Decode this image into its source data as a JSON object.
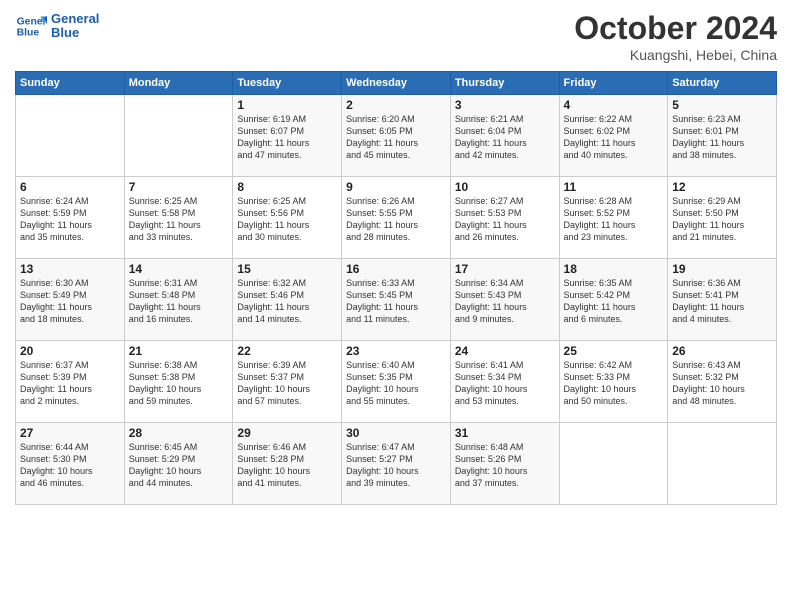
{
  "header": {
    "logo_line1": "General",
    "logo_line2": "Blue",
    "title": "October 2024",
    "subtitle": "Kuangshi, Hebei, China"
  },
  "days_of_week": [
    "Sunday",
    "Monday",
    "Tuesday",
    "Wednesday",
    "Thursday",
    "Friday",
    "Saturday"
  ],
  "weeks": [
    [
      {
        "day": "",
        "lines": []
      },
      {
        "day": "",
        "lines": []
      },
      {
        "day": "1",
        "lines": [
          "Sunrise: 6:19 AM",
          "Sunset: 6:07 PM",
          "Daylight: 11 hours",
          "and 47 minutes."
        ]
      },
      {
        "day": "2",
        "lines": [
          "Sunrise: 6:20 AM",
          "Sunset: 6:05 PM",
          "Daylight: 11 hours",
          "and 45 minutes."
        ]
      },
      {
        "day": "3",
        "lines": [
          "Sunrise: 6:21 AM",
          "Sunset: 6:04 PM",
          "Daylight: 11 hours",
          "and 42 minutes."
        ]
      },
      {
        "day": "4",
        "lines": [
          "Sunrise: 6:22 AM",
          "Sunset: 6:02 PM",
          "Daylight: 11 hours",
          "and 40 minutes."
        ]
      },
      {
        "day": "5",
        "lines": [
          "Sunrise: 6:23 AM",
          "Sunset: 6:01 PM",
          "Daylight: 11 hours",
          "and 38 minutes."
        ]
      }
    ],
    [
      {
        "day": "6",
        "lines": [
          "Sunrise: 6:24 AM",
          "Sunset: 5:59 PM",
          "Daylight: 11 hours",
          "and 35 minutes."
        ]
      },
      {
        "day": "7",
        "lines": [
          "Sunrise: 6:25 AM",
          "Sunset: 5:58 PM",
          "Daylight: 11 hours",
          "and 33 minutes."
        ]
      },
      {
        "day": "8",
        "lines": [
          "Sunrise: 6:25 AM",
          "Sunset: 5:56 PM",
          "Daylight: 11 hours",
          "and 30 minutes."
        ]
      },
      {
        "day": "9",
        "lines": [
          "Sunrise: 6:26 AM",
          "Sunset: 5:55 PM",
          "Daylight: 11 hours",
          "and 28 minutes."
        ]
      },
      {
        "day": "10",
        "lines": [
          "Sunrise: 6:27 AM",
          "Sunset: 5:53 PM",
          "Daylight: 11 hours",
          "and 26 minutes."
        ]
      },
      {
        "day": "11",
        "lines": [
          "Sunrise: 6:28 AM",
          "Sunset: 5:52 PM",
          "Daylight: 11 hours",
          "and 23 minutes."
        ]
      },
      {
        "day": "12",
        "lines": [
          "Sunrise: 6:29 AM",
          "Sunset: 5:50 PM",
          "Daylight: 11 hours",
          "and 21 minutes."
        ]
      }
    ],
    [
      {
        "day": "13",
        "lines": [
          "Sunrise: 6:30 AM",
          "Sunset: 5:49 PM",
          "Daylight: 11 hours",
          "and 18 minutes."
        ]
      },
      {
        "day": "14",
        "lines": [
          "Sunrise: 6:31 AM",
          "Sunset: 5:48 PM",
          "Daylight: 11 hours",
          "and 16 minutes."
        ]
      },
      {
        "day": "15",
        "lines": [
          "Sunrise: 6:32 AM",
          "Sunset: 5:46 PM",
          "Daylight: 11 hours",
          "and 14 minutes."
        ]
      },
      {
        "day": "16",
        "lines": [
          "Sunrise: 6:33 AM",
          "Sunset: 5:45 PM",
          "Daylight: 11 hours",
          "and 11 minutes."
        ]
      },
      {
        "day": "17",
        "lines": [
          "Sunrise: 6:34 AM",
          "Sunset: 5:43 PM",
          "Daylight: 11 hours",
          "and 9 minutes."
        ]
      },
      {
        "day": "18",
        "lines": [
          "Sunrise: 6:35 AM",
          "Sunset: 5:42 PM",
          "Daylight: 11 hours",
          "and 6 minutes."
        ]
      },
      {
        "day": "19",
        "lines": [
          "Sunrise: 6:36 AM",
          "Sunset: 5:41 PM",
          "Daylight: 11 hours",
          "and 4 minutes."
        ]
      }
    ],
    [
      {
        "day": "20",
        "lines": [
          "Sunrise: 6:37 AM",
          "Sunset: 5:39 PM",
          "Daylight: 11 hours",
          "and 2 minutes."
        ]
      },
      {
        "day": "21",
        "lines": [
          "Sunrise: 6:38 AM",
          "Sunset: 5:38 PM",
          "Daylight: 10 hours",
          "and 59 minutes."
        ]
      },
      {
        "day": "22",
        "lines": [
          "Sunrise: 6:39 AM",
          "Sunset: 5:37 PM",
          "Daylight: 10 hours",
          "and 57 minutes."
        ]
      },
      {
        "day": "23",
        "lines": [
          "Sunrise: 6:40 AM",
          "Sunset: 5:35 PM",
          "Daylight: 10 hours",
          "and 55 minutes."
        ]
      },
      {
        "day": "24",
        "lines": [
          "Sunrise: 6:41 AM",
          "Sunset: 5:34 PM",
          "Daylight: 10 hours",
          "and 53 minutes."
        ]
      },
      {
        "day": "25",
        "lines": [
          "Sunrise: 6:42 AM",
          "Sunset: 5:33 PM",
          "Daylight: 10 hours",
          "and 50 minutes."
        ]
      },
      {
        "day": "26",
        "lines": [
          "Sunrise: 6:43 AM",
          "Sunset: 5:32 PM",
          "Daylight: 10 hours",
          "and 48 minutes."
        ]
      }
    ],
    [
      {
        "day": "27",
        "lines": [
          "Sunrise: 6:44 AM",
          "Sunset: 5:30 PM",
          "Daylight: 10 hours",
          "and 46 minutes."
        ]
      },
      {
        "day": "28",
        "lines": [
          "Sunrise: 6:45 AM",
          "Sunset: 5:29 PM",
          "Daylight: 10 hours",
          "and 44 minutes."
        ]
      },
      {
        "day": "29",
        "lines": [
          "Sunrise: 6:46 AM",
          "Sunset: 5:28 PM",
          "Daylight: 10 hours",
          "and 41 minutes."
        ]
      },
      {
        "day": "30",
        "lines": [
          "Sunrise: 6:47 AM",
          "Sunset: 5:27 PM",
          "Daylight: 10 hours",
          "and 39 minutes."
        ]
      },
      {
        "day": "31",
        "lines": [
          "Sunrise: 6:48 AM",
          "Sunset: 5:26 PM",
          "Daylight: 10 hours",
          "and 37 minutes."
        ]
      },
      {
        "day": "",
        "lines": []
      },
      {
        "day": "",
        "lines": []
      }
    ]
  ]
}
